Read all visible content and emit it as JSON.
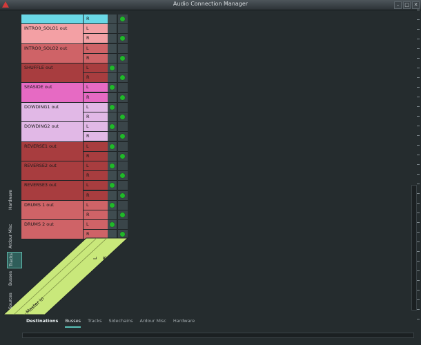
{
  "window": {
    "title": "Audio Connection Manager",
    "controls": [
      "–",
      "□",
      "✕"
    ]
  },
  "tracks": [
    {
      "name": "",
      "color": "#6ad8e6",
      "ports": [
        "R"
      ],
      "conn": [
        false,
        true
      ],
      "partial": true
    },
    {
      "name": "INTRO0_SOLO1 out",
      "color": "#f3a0a4",
      "ports": [
        "L",
        "R"
      ],
      "conn": [
        false,
        true
      ]
    },
    {
      "name": "INTRO0_SOLO2 out",
      "color": "#cf6367",
      "ports": [
        "L",
        "R"
      ],
      "conn": [
        false,
        true
      ]
    },
    {
      "name": "SHUFFLE out",
      "color": "#a83d3f",
      "ports": [
        "L",
        "R"
      ],
      "conn": [
        true,
        true
      ]
    },
    {
      "name": "SEASIDE out",
      "color": "#e66ac3",
      "ports": [
        "L",
        "R"
      ],
      "conn": [
        true,
        true
      ]
    },
    {
      "name": "DOWDING1 out",
      "color": "#e1b8e6",
      "ports": [
        "L",
        "R"
      ],
      "conn": [
        true,
        true
      ]
    },
    {
      "name": "DOWDING2 out",
      "color": "#e1b8e6",
      "ports": [
        "L",
        "R"
      ],
      "conn": [
        true,
        true
      ]
    },
    {
      "name": "REVERSE1 out",
      "color": "#a83d3f",
      "ports": [
        "L",
        "R"
      ],
      "conn": [
        true,
        true
      ]
    },
    {
      "name": "REVERSE2 out",
      "color": "#a83d3f",
      "ports": [
        "L",
        "R"
      ],
      "conn": [
        true,
        true
      ]
    },
    {
      "name": "REVERSE3 out",
      "color": "#a83d3f",
      "ports": [
        "L",
        "R"
      ],
      "conn": [
        true,
        true
      ]
    },
    {
      "name": "DRUMS 1 out",
      "color": "#cf6367",
      "ports": [
        "L",
        "R"
      ],
      "conn": [
        true,
        true
      ]
    },
    {
      "name": "DRUMS 2 out",
      "color": "#cf6367",
      "ports": [
        "L",
        "R"
      ],
      "conn": [
        true,
        true
      ]
    }
  ],
  "bus": {
    "name": "Master in",
    "ports": [
      "L",
      "R"
    ],
    "color": "#c9e87b"
  },
  "side_tabs": [
    {
      "label": "Hardware",
      "active": false
    },
    {
      "label": "Ardour Misc",
      "active": false
    },
    {
      "label": "Tracks",
      "active": true
    },
    {
      "label": "Busses",
      "active": false
    },
    {
      "label": "Sources",
      "active": false
    }
  ],
  "bottom": {
    "label": "Destinations",
    "tabs": [
      {
        "label": "Busses",
        "active": true
      },
      {
        "label": "Tracks",
        "active": false
      },
      {
        "label": "Sidechains",
        "active": false
      },
      {
        "label": "Ardour Misc",
        "active": false
      },
      {
        "label": "Hardware",
        "active": false
      }
    ]
  },
  "colors": {
    "accent": "#59c2b8",
    "connection_dot": "#21b82a"
  }
}
